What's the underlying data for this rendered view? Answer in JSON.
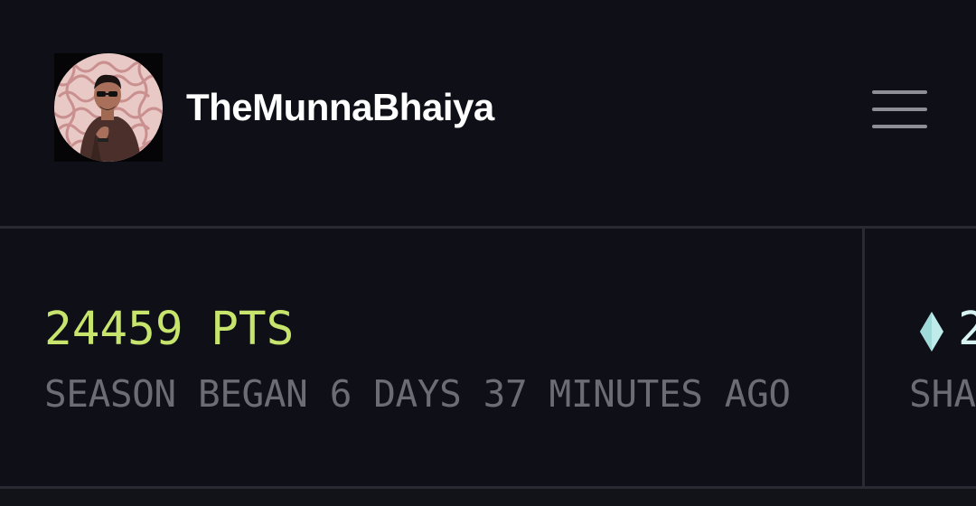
{
  "profile": {
    "username": "TheMunnaBhaiya",
    "avatar": "avatar-photo",
    "menu_icon": "hamburger-menu-icon"
  },
  "stats": {
    "points": "24459 PTS",
    "points_color": "#c7e46d",
    "season_info": "SEASON BEGAN 6 DAYS 37 MINUTES AGO",
    "shards_icon": "diamond-gem-icon",
    "shards_value": "2",
    "shards_label": "SHA"
  },
  "colors": {
    "background": "#0f0f17",
    "divider": "#2a2a33",
    "muted_text": "#6c6c75",
    "gem": "#bfecea"
  }
}
